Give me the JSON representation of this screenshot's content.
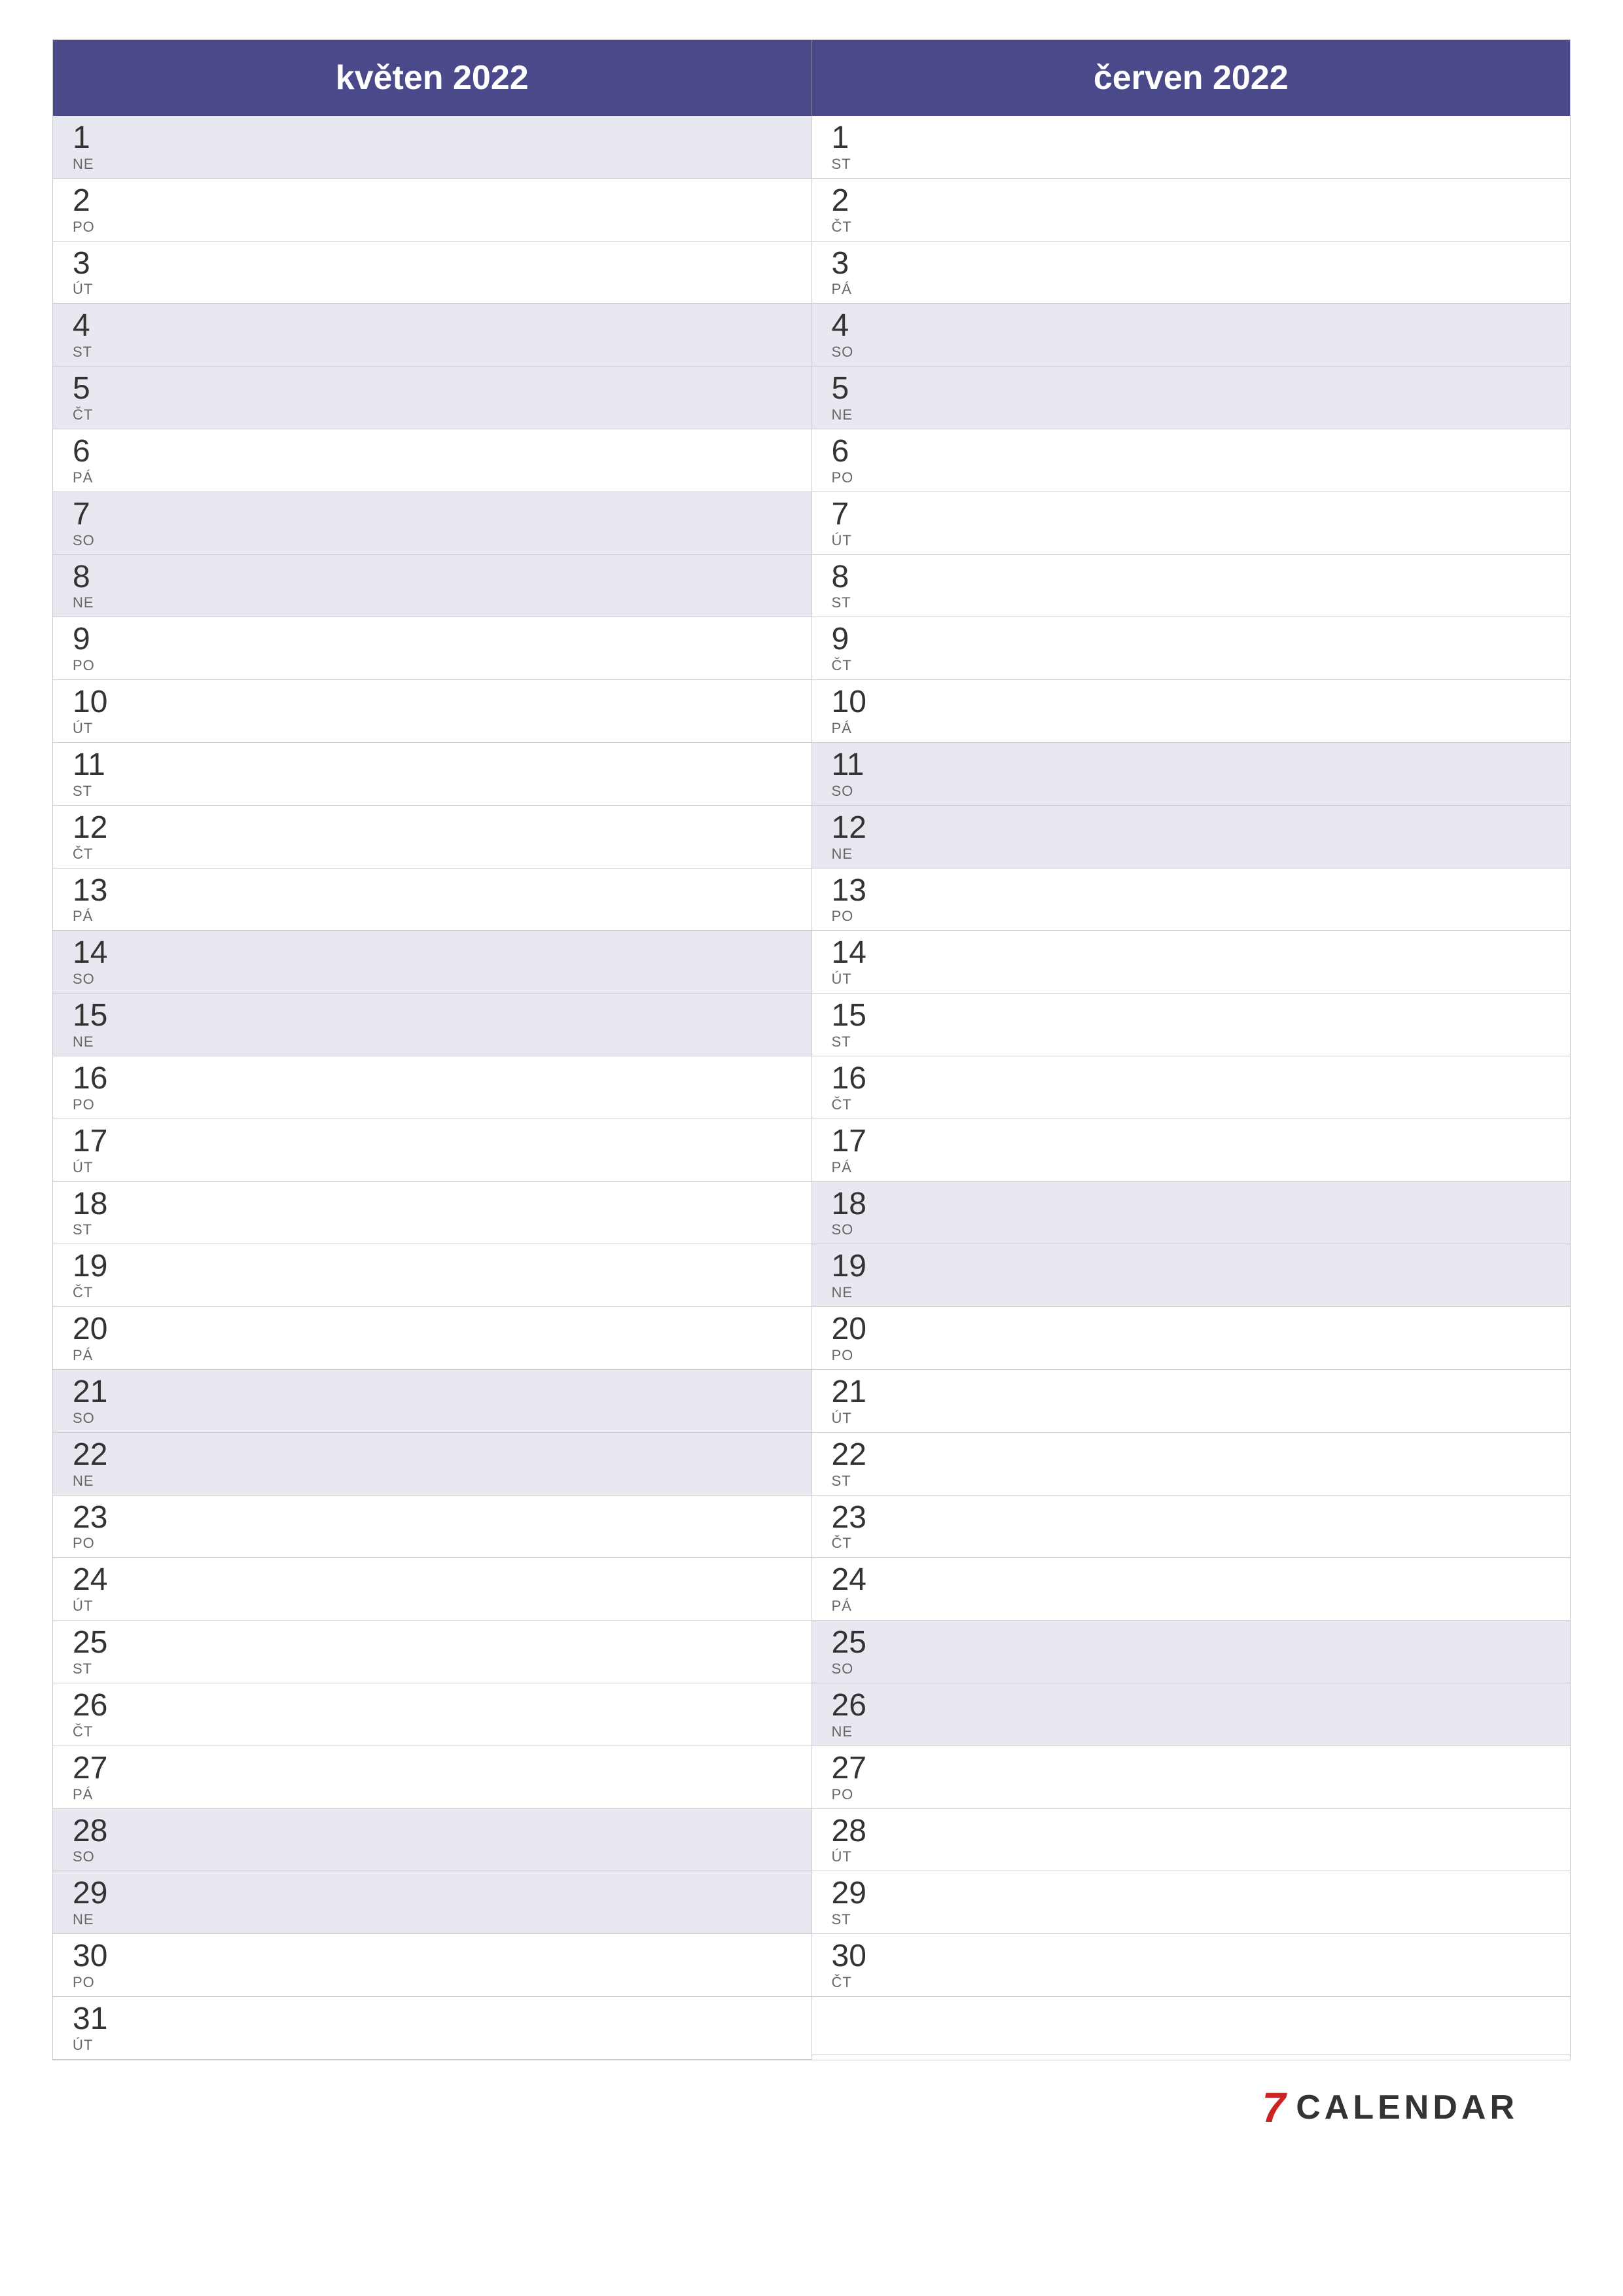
{
  "months": [
    {
      "title": "květen 2022",
      "days": [
        {
          "num": "1",
          "abbr": "NE",
          "weekend": true
        },
        {
          "num": "2",
          "abbr": "PO",
          "weekend": false
        },
        {
          "num": "3",
          "abbr": "ÚT",
          "weekend": false
        },
        {
          "num": "4",
          "abbr": "ST",
          "weekend": true
        },
        {
          "num": "5",
          "abbr": "ČT",
          "weekend": true
        },
        {
          "num": "6",
          "abbr": "PÁ",
          "weekend": false
        },
        {
          "num": "7",
          "abbr": "SO",
          "weekend": true
        },
        {
          "num": "8",
          "abbr": "NE",
          "weekend": true
        },
        {
          "num": "9",
          "abbr": "PO",
          "weekend": false
        },
        {
          "num": "10",
          "abbr": "ÚT",
          "weekend": false
        },
        {
          "num": "11",
          "abbr": "ST",
          "weekend": false
        },
        {
          "num": "12",
          "abbr": "ČT",
          "weekend": false
        },
        {
          "num": "13",
          "abbr": "PÁ",
          "weekend": false
        },
        {
          "num": "14",
          "abbr": "SO",
          "weekend": true
        },
        {
          "num": "15",
          "abbr": "NE",
          "weekend": true
        },
        {
          "num": "16",
          "abbr": "PO",
          "weekend": false
        },
        {
          "num": "17",
          "abbr": "ÚT",
          "weekend": false
        },
        {
          "num": "18",
          "abbr": "ST",
          "weekend": false
        },
        {
          "num": "19",
          "abbr": "ČT",
          "weekend": false
        },
        {
          "num": "20",
          "abbr": "PÁ",
          "weekend": false
        },
        {
          "num": "21",
          "abbr": "SO",
          "weekend": true
        },
        {
          "num": "22",
          "abbr": "NE",
          "weekend": true
        },
        {
          "num": "23",
          "abbr": "PO",
          "weekend": false
        },
        {
          "num": "24",
          "abbr": "ÚT",
          "weekend": false
        },
        {
          "num": "25",
          "abbr": "ST",
          "weekend": false
        },
        {
          "num": "26",
          "abbr": "ČT",
          "weekend": false
        },
        {
          "num": "27",
          "abbr": "PÁ",
          "weekend": false
        },
        {
          "num": "28",
          "abbr": "SO",
          "weekend": true
        },
        {
          "num": "29",
          "abbr": "NE",
          "weekend": true
        },
        {
          "num": "30",
          "abbr": "PO",
          "weekend": false
        },
        {
          "num": "31",
          "abbr": "ÚT",
          "weekend": false
        }
      ]
    },
    {
      "title": "červen 2022",
      "days": [
        {
          "num": "1",
          "abbr": "ST",
          "weekend": false
        },
        {
          "num": "2",
          "abbr": "ČT",
          "weekend": false
        },
        {
          "num": "3",
          "abbr": "PÁ",
          "weekend": false
        },
        {
          "num": "4",
          "abbr": "SO",
          "weekend": true
        },
        {
          "num": "5",
          "abbr": "NE",
          "weekend": true
        },
        {
          "num": "6",
          "abbr": "PO",
          "weekend": false
        },
        {
          "num": "7",
          "abbr": "ÚT",
          "weekend": false
        },
        {
          "num": "8",
          "abbr": "ST",
          "weekend": false
        },
        {
          "num": "9",
          "abbr": "ČT",
          "weekend": false
        },
        {
          "num": "10",
          "abbr": "PÁ",
          "weekend": false
        },
        {
          "num": "11",
          "abbr": "SO",
          "weekend": true
        },
        {
          "num": "12",
          "abbr": "NE",
          "weekend": true
        },
        {
          "num": "13",
          "abbr": "PO",
          "weekend": false
        },
        {
          "num": "14",
          "abbr": "ÚT",
          "weekend": false
        },
        {
          "num": "15",
          "abbr": "ST",
          "weekend": false
        },
        {
          "num": "16",
          "abbr": "ČT",
          "weekend": false
        },
        {
          "num": "17",
          "abbr": "PÁ",
          "weekend": false
        },
        {
          "num": "18",
          "abbr": "SO",
          "weekend": true
        },
        {
          "num": "19",
          "abbr": "NE",
          "weekend": true
        },
        {
          "num": "20",
          "abbr": "PO",
          "weekend": false
        },
        {
          "num": "21",
          "abbr": "ÚT",
          "weekend": false
        },
        {
          "num": "22",
          "abbr": "ST",
          "weekend": false
        },
        {
          "num": "23",
          "abbr": "ČT",
          "weekend": false
        },
        {
          "num": "24",
          "abbr": "PÁ",
          "weekend": false
        },
        {
          "num": "25",
          "abbr": "SO",
          "weekend": true
        },
        {
          "num": "26",
          "abbr": "NE",
          "weekend": true
        },
        {
          "num": "27",
          "abbr": "PO",
          "weekend": false
        },
        {
          "num": "28",
          "abbr": "ÚT",
          "weekend": false
        },
        {
          "num": "29",
          "abbr": "ST",
          "weekend": false
        },
        {
          "num": "30",
          "abbr": "ČT",
          "weekend": false
        }
      ]
    }
  ],
  "logo": {
    "icon": "7",
    "text": "CALENDAR"
  },
  "colors": {
    "header_bg": "#4a4a8a",
    "weekend_bg": "#e8e8f0",
    "weekday_bg": "#ffffff",
    "logo_icon_color": "#cc2222"
  }
}
